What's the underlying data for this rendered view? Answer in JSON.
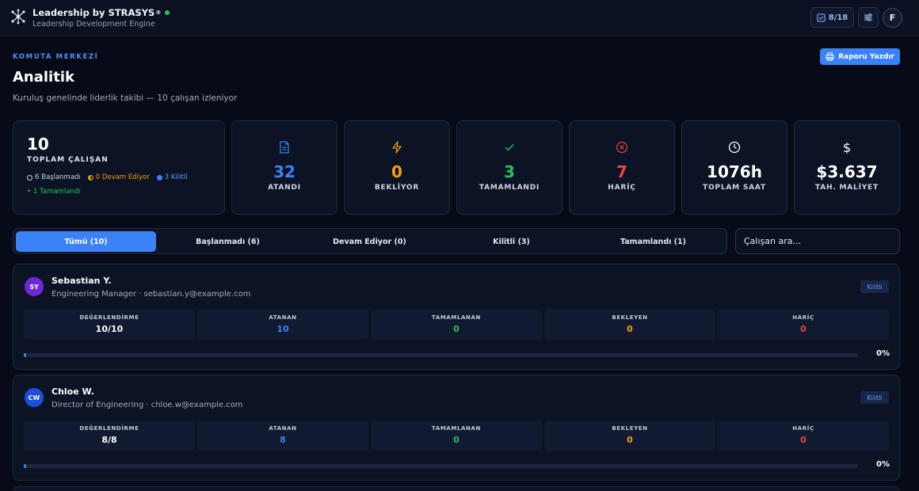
{
  "header": {
    "brand": "Leadership by STRASYS",
    "registered": "®",
    "tagline": "Leadership Development Engine",
    "progress_badge": "8/18",
    "avatar_initial": "F"
  },
  "page": {
    "kicker": "KOMUTA MERKEZİ",
    "title": "Analitik",
    "subtitle": "Kuruluş genelinde liderlik takibi — 10 çalışan izleniyor",
    "print_button": "Raporu Yazdır"
  },
  "summary": {
    "total": "10",
    "total_label": "TOPLAM ÇALIŞAN",
    "status_chips": [
      {
        "text": "6 Başlanmadı",
        "color": "#cbd5e1"
      },
      {
        "text": "0 Devam Ediyor",
        "color": "#f59e0b"
      },
      {
        "text": "3 Kilitli",
        "color": "#60a5fa"
      },
      {
        "text": "1 Tamamlandı",
        "color": "#22c55e"
      }
    ]
  },
  "stats": [
    {
      "icon": "document-icon",
      "value": "32",
      "label": "ATANDI",
      "color": "#3b82f6"
    },
    {
      "icon": "lightning-icon",
      "value": "0",
      "label": "BEKLİYOR",
      "color": "#f59e0b"
    },
    {
      "icon": "check-icon",
      "value": "3",
      "label": "TAMAMLANDI",
      "color": "#22c55e"
    },
    {
      "icon": "x-circle-icon",
      "value": "7",
      "label": "HARİÇ",
      "color": "#ef4444"
    },
    {
      "icon": "clock-icon",
      "value": "1076h",
      "label": "TOPLAM SAAT",
      "color": "#ffffff"
    },
    {
      "icon": "dollar-icon",
      "value": "$3.637",
      "label": "TAH. MALİYET",
      "color": "#ffffff"
    }
  ],
  "filters": {
    "tabs": [
      "Tümü (10)",
      "Başlanmadı (6)",
      "Devam Ediyor (0)",
      "Kilitli (3)",
      "Tamamlandı (1)"
    ],
    "active_tab": "Tümü (10)",
    "search_placeholder": "Çalışan ara..."
  },
  "employees": [
    {
      "initials": "SY",
      "avatar_color": "#6d28d9",
      "name": "Sebastian Y.",
      "role": "Engineering Manager · sebastian.y@example.com",
      "status": "Kilitli",
      "metrics": [
        {
          "label": "DEĞERLENDİRME",
          "value": "10/10",
          "color": "#ffffff"
        },
        {
          "label": "ATANAN",
          "value": "10",
          "color": "#3b82f6"
        },
        {
          "label": "TAMAMLANAN",
          "value": "0",
          "color": "#22c55e"
        },
        {
          "label": "BEKLEYEN",
          "value": "0",
          "color": "#f59e0b"
        },
        {
          "label": "HARİÇ",
          "value": "0",
          "color": "#ef4444"
        }
      ],
      "progress": "0%",
      "progress_value": 0
    },
    {
      "initials": "CW",
      "avatar_color": "#1d4ed8",
      "name": "Chloe W.",
      "role": "Director of Engineering · chloe.w@example.com",
      "status": "Kilitli",
      "metrics": [
        {
          "label": "DEĞERLENDİRME",
          "value": "8/8",
          "color": "#ffffff"
        },
        {
          "label": "ATANAN",
          "value": "8",
          "color": "#3b82f6"
        },
        {
          "label": "TAMAMLANAN",
          "value": "0",
          "color": "#22c55e"
        },
        {
          "label": "BEKLEYEN",
          "value": "0",
          "color": "#f59e0b"
        },
        {
          "label": "HARİÇ",
          "value": "0",
          "color": "#ef4444"
        }
      ],
      "progress": "0%",
      "progress_value": 0
    }
  ]
}
